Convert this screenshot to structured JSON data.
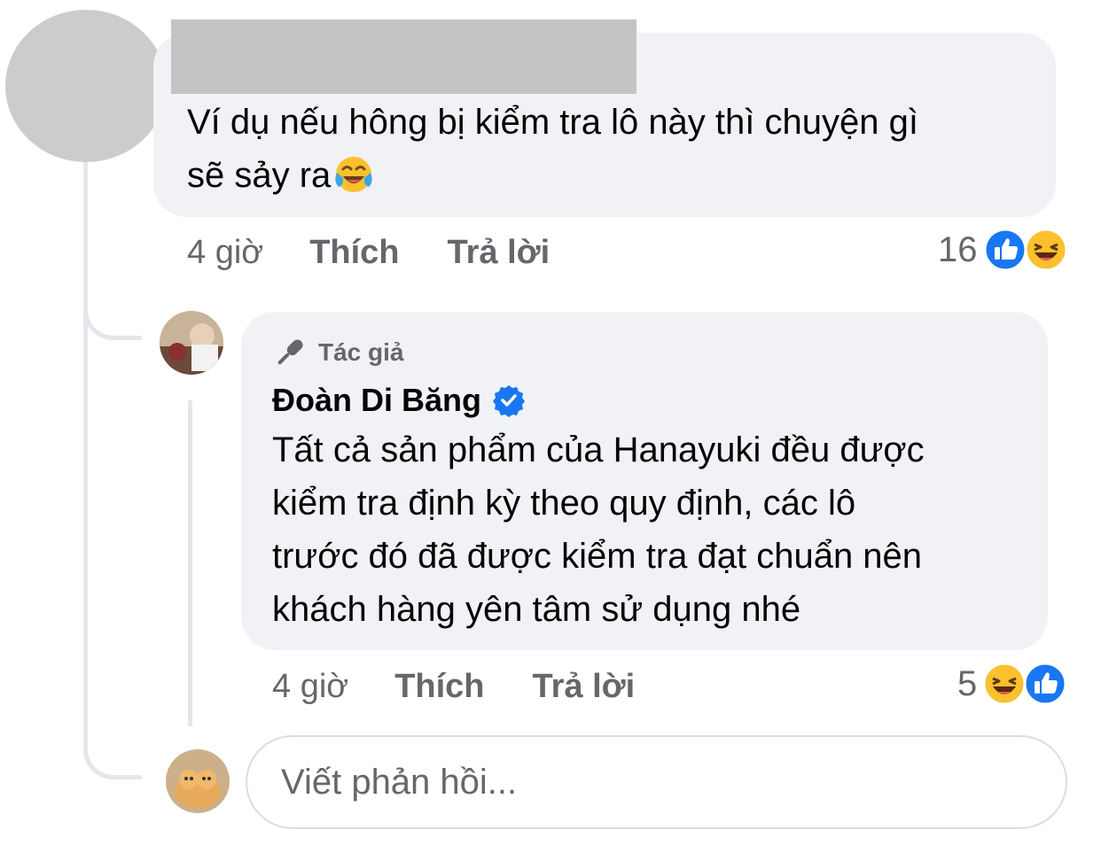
{
  "colors": {
    "bubble": "#f0f2f5",
    "secondary_text": "#65676b",
    "primary_text": "#050505",
    "like_blue": "#1877f2",
    "haha_yellow": "#fbc02d",
    "thread_line": "#e4e6eb"
  },
  "comment": {
    "author_name_redacted": true,
    "text_line1": "Ví dụ nếu hông bị kiểm tra lô này thì chuyện gì",
    "text_line2": "sẽ sảy ra",
    "inline_emoji": "face-with-tears-of-joy-icon",
    "time": "4 giờ",
    "like_label": "Thích",
    "reply_label": "Trả lời",
    "reaction_count": "16",
    "reaction_icons": [
      "like-reaction-icon",
      "haha-reaction-icon"
    ]
  },
  "reply": {
    "badge_label": "Tác giả",
    "badge_icon": "microphone-icon",
    "author_name": "Đoàn Di Băng",
    "verified_icon": "verified-badge-icon",
    "text": "Tất cả sản phẩm của Hanayuki đều được\nkiểm tra định kỳ theo quy định, các lô\ntrước đó đã được kiểm tra đạt chuẩn nên\nkhách hàng yên tâm sử dụng nhé",
    "time": "4 giờ",
    "like_label": "Thích",
    "reply_label": "Trả lời",
    "reaction_count": "5",
    "reaction_icons": [
      "haha-reaction-icon",
      "like-reaction-icon"
    ]
  },
  "composer": {
    "placeholder": "Viết phản hồi..."
  }
}
